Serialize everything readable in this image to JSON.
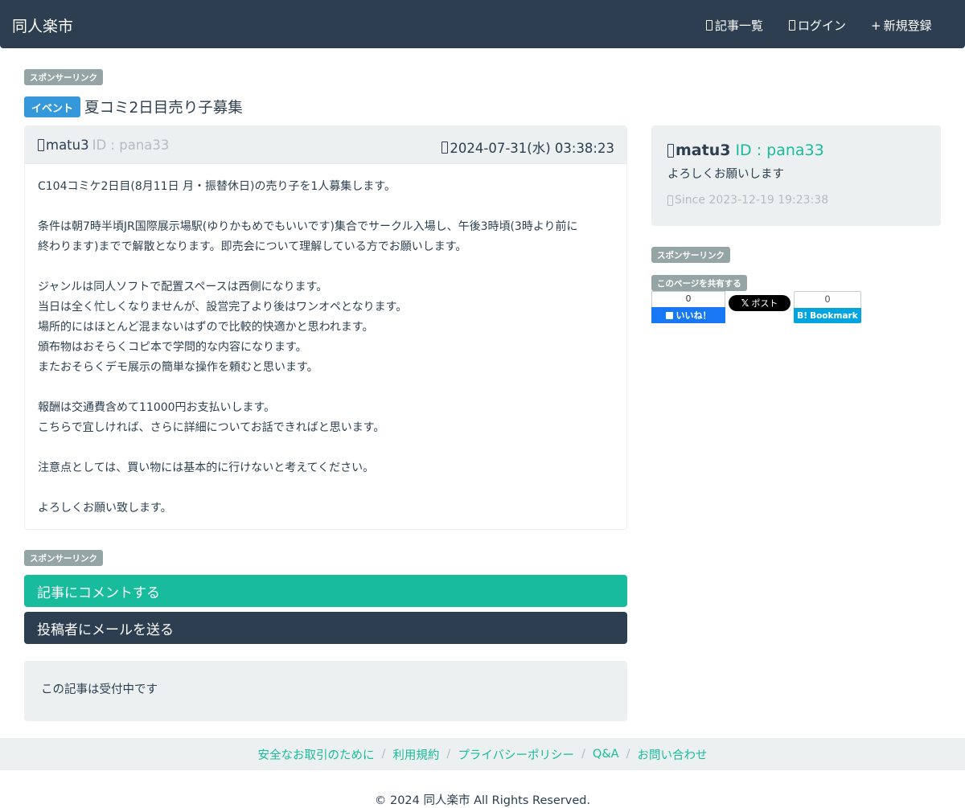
{
  "navbar": {
    "brand": "同人楽市",
    "items": [
      {
        "label": "記事一覧"
      },
      {
        "label": "ログイン"
      },
      {
        "label": "新規登録",
        "prefix": "+"
      }
    ]
  },
  "sponsor_label": "スポンサーリンク",
  "post": {
    "category": "イベント",
    "title": "夏コミ2日目売り子募集",
    "author": "matu3",
    "author_id": "ID : pana33",
    "datetime": "2024-07-31(水) 03:38:23",
    "body": [
      "C104コミケ2日目(8月11日 月・振替休日)の売り子を1人募集します。",
      "",
      "条件は朝7時半頃JR国際展示場駅(ゆりかもめでもいいです)集合でサークル入場し、午後3時頃(3時より前に",
      "終わります)までで解散となります。即売会について理解している方でお願いします。",
      "",
      "ジャンルは同人ソフトで配置スペースは西側になります。",
      "当日は全く忙しくなりませんが、設営完了より後はワンオペとなります。",
      "場所的にはほとんど混まないはずので比較的快適かと思われます。",
      "頒布物はおそらくコピ本で学問的な内容になります。",
      "またおそらくデモ展示の簡単な操作を頼むと思います。",
      "",
      "報酬は交通費含めて11000円お支払いします。",
      "こちらで宜しければ、さらに詳細についてお話できればと思います。",
      "",
      "注意点としては、買い物には基本的に行けないと考えてください。",
      "",
      "よろしくお願い致します。"
    ]
  },
  "actions": {
    "comment": "記事にコメントする",
    "mail": "投稿者にメールを送る"
  },
  "status": "この記事は受付中です",
  "profile": {
    "name": "matu3",
    "id": "ID : pana33",
    "bio": "よろしくお願いします",
    "since": "Since 2023-12-19 19:23:38"
  },
  "share": {
    "label": "このページを共有する",
    "facebook_count": "0",
    "facebook_label": "いいね！",
    "x_label": "ポスト",
    "hatena_count": "0",
    "hatena_label": "Bookmark"
  },
  "footer": {
    "links": [
      "安全なお取引のために",
      "利用規約",
      "プライバシーポリシー",
      "Q&A",
      "お問い合わせ"
    ],
    "copyright": "© 2024 同人楽市 All Rights Reserved."
  },
  "colors": {
    "navbar": "#2c3e50",
    "accent": "#18bc9c",
    "category": "#3498db",
    "badge": "#95a5a6",
    "well": "#ecf0f1"
  }
}
